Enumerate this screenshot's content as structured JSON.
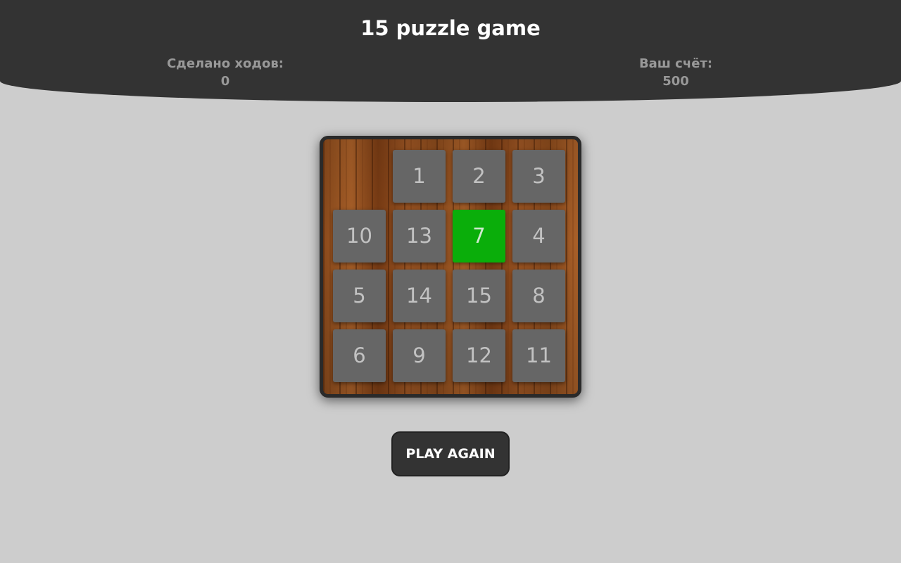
{
  "header": {
    "title": "15 puzzle game",
    "moves_label": "Сделано ходов:",
    "moves_value": "0",
    "score_label": "Ваш счёт:",
    "score_value": "500"
  },
  "board": {
    "rows": [
      [
        null,
        "1",
        "2",
        "3"
      ],
      [
        "10",
        "13",
        "7",
        "4"
      ],
      [
        "5",
        "14",
        "15",
        "8"
      ],
      [
        "6",
        "9",
        "12",
        "11"
      ]
    ],
    "highlighted_tile": "7",
    "highlight_color": "#0aae0a",
    "tile_color": "#666666"
  },
  "controls": {
    "play_again_label": "PLAY AGAIN"
  }
}
